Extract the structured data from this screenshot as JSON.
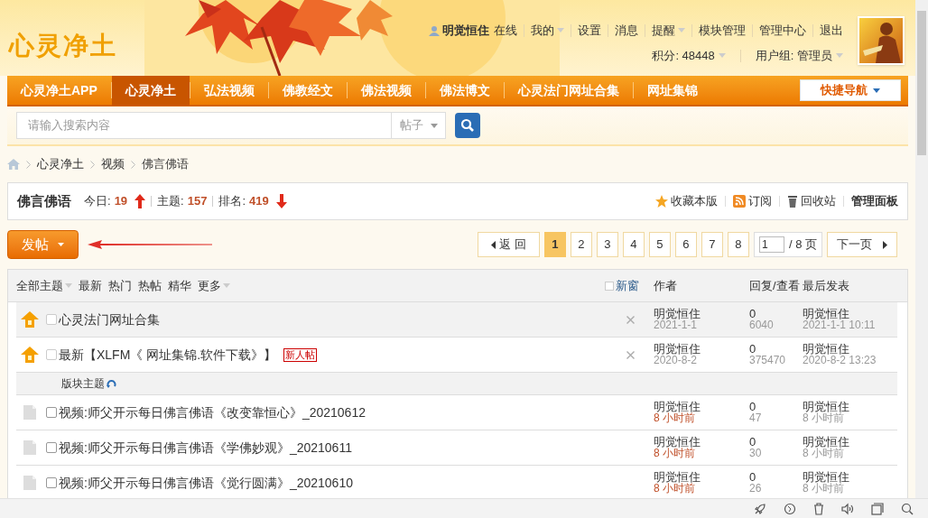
{
  "logo": "心灵净土",
  "user_bar": {
    "username": "明觉恒住",
    "status": "在线",
    "links": [
      {
        "label": "我的",
        "dropdown": true
      },
      {
        "label": "设置",
        "dropdown": false
      },
      {
        "label": "消息",
        "dropdown": false
      },
      {
        "label": "提醒",
        "dropdown": true
      },
      {
        "label": "模块管理",
        "dropdown": false
      },
      {
        "label": "管理中心",
        "dropdown": false
      },
      {
        "label": "退出",
        "dropdown": false
      }
    ],
    "points": "积分: 48448",
    "group": "用户组: 管理员"
  },
  "nav": [
    {
      "label": "心灵净土APP",
      "selected": false
    },
    {
      "label": "心灵净土",
      "selected": true
    },
    {
      "label": "弘法视频",
      "selected": false
    },
    {
      "label": "佛教经文",
      "selected": false
    },
    {
      "label": "佛法视频",
      "selected": false
    },
    {
      "label": "佛法博文",
      "selected": false
    },
    {
      "label": "心灵法门网址合集",
      "selected": false
    },
    {
      "label": "网址集锦",
      "selected": false
    }
  ],
  "quick_nav": "快捷导航",
  "search": {
    "placeholder": "请输入搜索内容",
    "type": "帖子"
  },
  "breadcrumb": [
    "心灵净土",
    "视频",
    "佛言佛语"
  ],
  "forum": {
    "name": "佛言佛语",
    "stats": [
      {
        "label": "今日:",
        "value": "19",
        "kind": "rising"
      },
      {
        "label": "主题:",
        "value": "157",
        "kind": "plain"
      },
      {
        "label": "排名:",
        "value": "419",
        "kind": "falling"
      }
    ],
    "actions": [
      {
        "kind": "star",
        "label": "收藏本版"
      },
      {
        "kind": "rss",
        "label": "订阅"
      },
      {
        "kind": "trash",
        "label": "回收站"
      },
      {
        "kind": "bold",
        "label": "管理面板"
      }
    ]
  },
  "post_button": "发帖",
  "pagination": {
    "back": "返 回",
    "pages": [
      {
        "label": "1",
        "selected": true
      },
      {
        "label": "2",
        "selected": false
      },
      {
        "label": "3",
        "selected": false
      },
      {
        "label": "4",
        "selected": false
      },
      {
        "label": "5",
        "selected": false
      },
      {
        "label": "6",
        "selected": false
      },
      {
        "label": "7",
        "selected": false
      },
      {
        "label": "8",
        "selected": false
      }
    ],
    "page_input": "1",
    "total": "/ 8 页",
    "next": "下一页"
  },
  "table": {
    "filters": [
      {
        "label": "全部主题",
        "dropdown": true
      },
      {
        "label": "最新",
        "dropdown": false
      },
      {
        "label": "热门",
        "dropdown": false
      },
      {
        "label": "热帖",
        "dropdown": false
      },
      {
        "label": "精华",
        "dropdown": false
      },
      {
        "label": "更多",
        "dropdown": true
      }
    ],
    "new_window": {
      "label": "新窗",
      "checked": false
    },
    "columns": [
      "作者",
      "回复/查看",
      "最后发表"
    ],
    "section_label": "版块主题",
    "rows": [
      {
        "kind": "sticky",
        "checked": false,
        "title": "心灵法门网址合集",
        "author": "明觉恒住",
        "date": "2021-1-1",
        "replies": "0",
        "views": "6040",
        "last_author": "明觉恒住",
        "last_date": "2021-1-1 10:11"
      },
      {
        "kind": "sticky",
        "checked": false,
        "title": "最新【XLFM《 网址集锦.软件下载》】",
        "badge": "新人帖",
        "author": "明觉恒住",
        "date": "2020-8-2",
        "replies": "0",
        "views": "375470",
        "last_author": "明觉恒住",
        "last_date": "2020-8-2 13:23"
      },
      {
        "kind": "normal",
        "checked": false,
        "title": "视频:师父开示每日佛言佛语《改变靠恒心》_20210612",
        "author": "明觉恒住",
        "date": "8 小时前",
        "replies": "0",
        "views": "47",
        "last_author": "明觉恒住",
        "last_date": "8 小时前"
      },
      {
        "kind": "normal",
        "checked": false,
        "title": "视频:师父开示每日佛言佛语《学佛妙观》_20210611",
        "author": "明觉恒住",
        "date": "8 小时前",
        "replies": "0",
        "views": "30",
        "last_author": "明觉恒住",
        "last_date": "8 小时前"
      },
      {
        "kind": "normal",
        "checked": false,
        "title": "视频:师父开示每日佛言佛语《觉行圆满》_20210610",
        "author": "明觉恒住",
        "date": "8 小时前",
        "replies": "0",
        "views": "26",
        "last_author": "明觉恒住",
        "last_date": "8 小时前"
      }
    ]
  }
}
